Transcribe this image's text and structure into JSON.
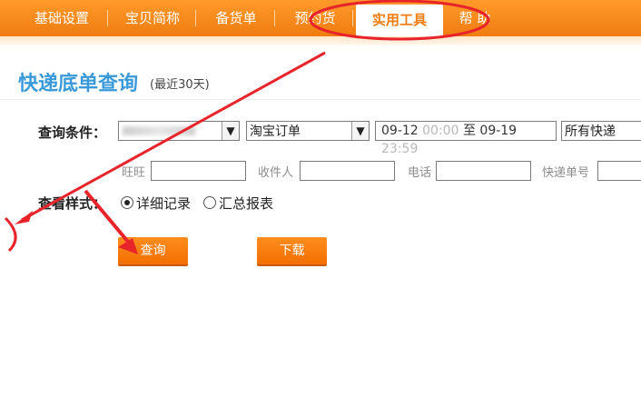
{
  "nav": {
    "items": [
      {
        "label": "基础设置"
      },
      {
        "label": "宝贝简称"
      },
      {
        "label": "备货单"
      },
      {
        "label": "预约货"
      },
      {
        "label": "实用工具",
        "active": true
      },
      {
        "label": "帮 助"
      }
    ]
  },
  "page": {
    "title": "快递底单查询",
    "subtitle": "(最近30天)"
  },
  "query": {
    "label": "查询条件：",
    "order_type": "淘宝订单",
    "date_from": "09-12",
    "time_from": "00:00",
    "range_sep": "至",
    "date_to": "09-19",
    "time_to": "23:59",
    "express": "所有快递"
  },
  "filters": {
    "wangwang_label": "旺旺",
    "receiver_label": "收件人",
    "phone_label": "电话",
    "tracking_label": "快递单号"
  },
  "view": {
    "label": "查看样式：",
    "options": [
      {
        "label": "详细记录",
        "selected": true
      },
      {
        "label": "汇总报表",
        "selected": false
      }
    ]
  },
  "buttons": {
    "query": "查询",
    "download": "下载"
  },
  "colors": {
    "nav_orange": "#f07c10",
    "title_blue": "#3a9ad9",
    "annotation_red": "#e8242b"
  }
}
